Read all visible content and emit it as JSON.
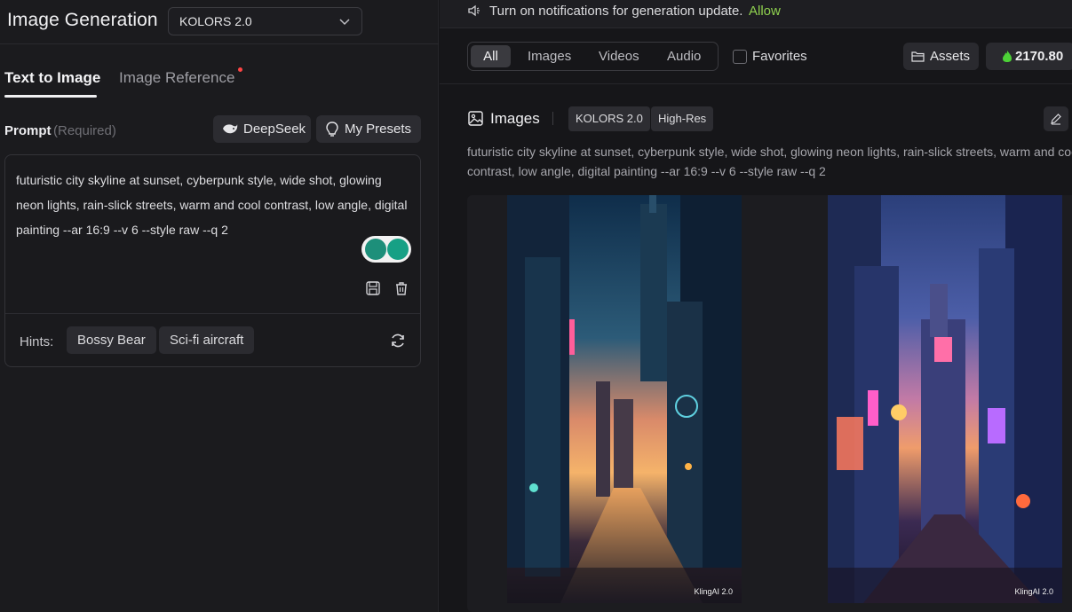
{
  "left": {
    "app_title": "Image Generation",
    "model": "KOLORS 2.0",
    "tabs": {
      "text_to_image": "Text to Image",
      "image_reference": "Image Reference"
    },
    "prompt": {
      "label": "Prompt",
      "required": "(Required)",
      "deepseek": "DeepSeek",
      "presets": "My Presets",
      "text": "futuristic city skyline at sunset, cyberpunk style, wide shot, glowing neon lights, rain-slick streets, warm and cool contrast, low angle, digital painting --ar 16:9 --v 6 --style raw --q 2"
    },
    "hints": {
      "label": "Hints:",
      "items": [
        "Bossy Bear",
        "Sci-fi aircraft"
      ]
    }
  },
  "right": {
    "notification": {
      "message": "Turn on notifications for generation update.",
      "allow": "Allow"
    },
    "filters": {
      "items": [
        "All",
        "Images",
        "Videos",
        "Audio"
      ],
      "selected": "All",
      "favorites": "Favorites"
    },
    "assets": "Assets",
    "credits": "2170.80",
    "section": {
      "title": "Images",
      "tags": [
        "KOLORS 2.0",
        "High-Res"
      ],
      "prompt_line1": "futuristic city skyline at sunset, cyberpunk style, wide shot, glowing neon lights, rain-slick streets, warm and coo",
      "prompt_line2": "contrast, low angle, digital painting --ar 16:9 --v 6 --style raw --q 2"
    },
    "images": [
      {
        "watermark": "KlingAI 2.0"
      },
      {
        "watermark": "KlingAI 2.0"
      }
    ]
  },
  "colors": {
    "allow_green": "#8fd14f",
    "credit_green": "#4cd137",
    "notify_dot": "#ff4545"
  }
}
